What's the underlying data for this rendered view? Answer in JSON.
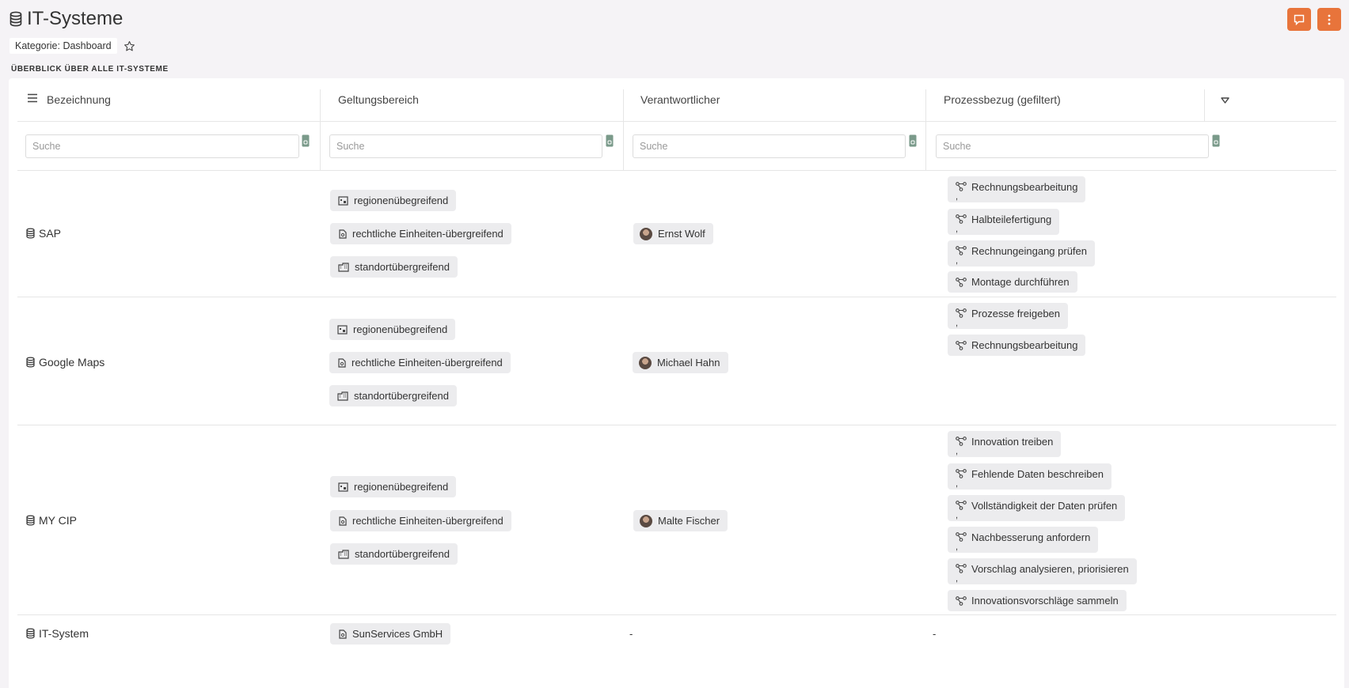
{
  "page": {
    "title": "IT-Systeme",
    "category": "Kategorie: Dashboard",
    "section_label": "ÜBERBLICK ÜBER ALLE IT-SYSTEME"
  },
  "table": {
    "columns": [
      "Bezeichnung",
      "Geltungsbereich",
      "Verantwortlicher",
      "Prozessbezug (gefiltert)"
    ],
    "search_placeholder": "Suche",
    "rows": [
      {
        "name": "SAP",
        "scopes": [
          "regionenübegreifend",
          "rechtliche Einheiten-übergreifend",
          "standortübergreifend"
        ],
        "owner": "Ernst Wolf",
        "processes": [
          "Rechnungsbearbeitung",
          "Halbteilefertigung",
          "Rechnungeingang prüfen",
          "Montage durchführen"
        ]
      },
      {
        "name": "Google Maps",
        "scopes": [
          "regionenübegreifend",
          "rechtliche Einheiten-übergreifend",
          "standortübergreifend"
        ],
        "owner": "Michael Hahn",
        "processes": [
          "Prozesse freigeben",
          "Rechnungsbearbeitung"
        ]
      },
      {
        "name": "MY CIP",
        "scopes": [
          "regionenübegreifend",
          "rechtliche Einheiten-übergreifend",
          "standortübergreifend"
        ],
        "owner": "Malte Fischer",
        "processes": [
          "Innovation treiben",
          "Fehlende Daten beschreiben",
          "Vollständigkeit der Daten prüfen",
          "Nachbesserung anfordern",
          "Vorschlag analysieren, priorisieren",
          "Innovationsvorschläge sammeln"
        ]
      },
      {
        "name": "IT-System",
        "scopes": [
          "SunServices GmbH"
        ],
        "owner": "-",
        "processes": [
          "-"
        ]
      }
    ]
  },
  "separator": ",",
  "colors": {
    "accent": "#e8743b",
    "chip_bg": "#ececee",
    "background": "#f5f3f6"
  },
  "icons": [
    "database-icon",
    "comment-icon",
    "more-vert-icon",
    "star-icon",
    "menu-icon",
    "sort-down-icon",
    "lock-icon",
    "region-icon",
    "legal-entity-icon",
    "building-icon",
    "process-icon",
    "avatar"
  ]
}
